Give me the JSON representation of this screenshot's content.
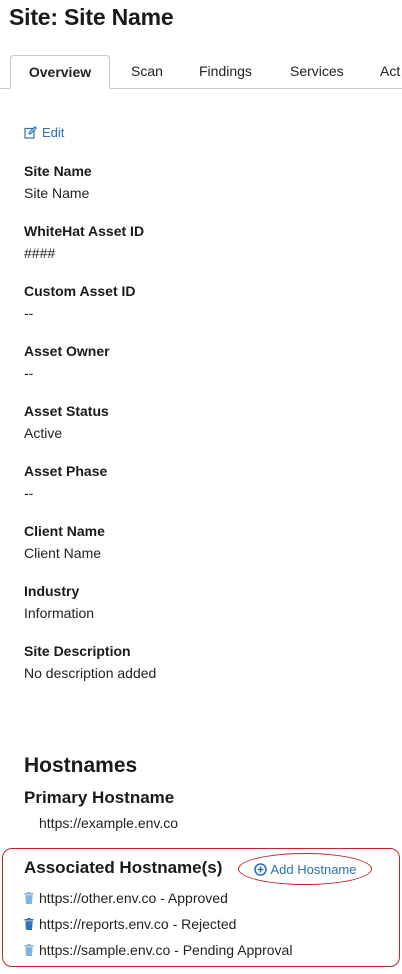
{
  "page_title": "Site: Site Name",
  "tabs": [
    {
      "label": "Overview",
      "active": true
    },
    {
      "label": "Scan",
      "active": false
    },
    {
      "label": "Findings",
      "active": false
    },
    {
      "label": "Services",
      "active": false
    },
    {
      "label": "Act",
      "active": false
    }
  ],
  "edit_label": "Edit",
  "fields": [
    {
      "label": "Site Name",
      "value": "Site Name"
    },
    {
      "label": "WhiteHat Asset ID",
      "value": "####"
    },
    {
      "label": "Custom Asset ID",
      "value": "--"
    },
    {
      "label": "Asset Owner",
      "value": "--"
    },
    {
      "label": "Asset Status",
      "value": "Active"
    },
    {
      "label": "Asset Phase",
      "value": "--"
    },
    {
      "label": "Client Name",
      "value": "Client Name"
    },
    {
      "label": "Industry",
      "value": "Information"
    },
    {
      "label": "Site Description",
      "value": "No description added"
    }
  ],
  "hostnames": {
    "title": "Hostnames",
    "primary_title": "Primary Hostname",
    "primary_value": "https://example.env.co",
    "associated_title": "Associated Hostname(s)",
    "add_label": "Add Hostname",
    "associated": [
      {
        "text": "https://other.env.co - Approved",
        "icon": "trash-icon",
        "color": "#7fb3e0"
      },
      {
        "text": "https://reports.env.co - Rejected",
        "icon": "trash-icon",
        "color": "#2b72b8"
      },
      {
        "text": "https://sample.env.co - Pending Approval",
        "icon": "trash-icon",
        "color": "#7fb3e0"
      }
    ]
  },
  "colors": {
    "link": "#2b72b8",
    "highlight": "#c0262d"
  }
}
